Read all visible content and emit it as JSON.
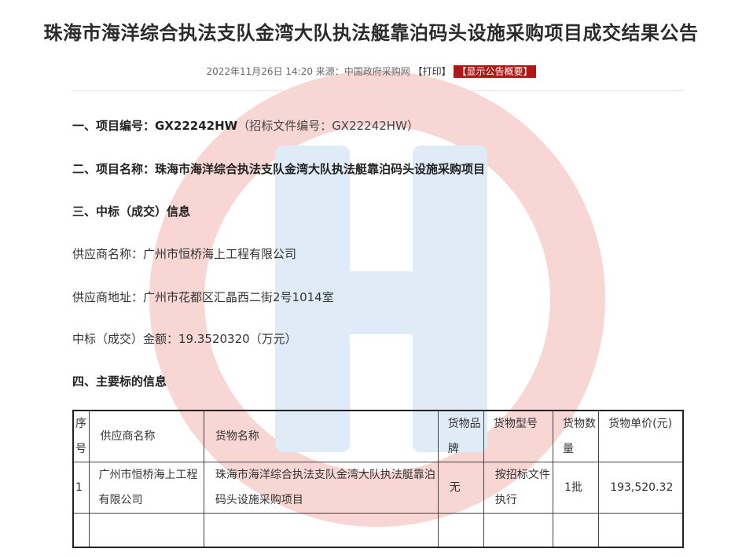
{
  "title": "珠海市海洋综合执法支队金湾大队执法艇靠泊码头设施采购项目成交结果公告",
  "meta": {
    "date": "2022年11月26日 14:20",
    "source": "来源：中国政府采购网",
    "print_label": "【打印】",
    "summary_label": "【显示公告概要】"
  },
  "sections": {
    "project_no_label": "一、项目编号：",
    "project_no_value": "GX22242HW",
    "project_no_extra": "（招标文件编号：GX22242HW）",
    "project_name_label": "二、项目名称：",
    "project_name_value": "珠海市海洋综合执法支队金湾大队执法艇靠泊码头设施采购项目",
    "award_heading": "三、中标（成交）信息",
    "supplier_name": "供应商名称：广州市恒桥海上工程有限公司",
    "supplier_address": "供应商地址：广州市花都区汇晶西二街2号1014室",
    "award_amount": "中标（成交）金额：19.3520320（万元）",
    "goods_heading": "四、主要标的信息"
  },
  "table": {
    "headers": {
      "seq": "序号",
      "supplier": "供应商名称",
      "goods_name": "货物名称",
      "brand": "货物品牌",
      "model": "货物型号",
      "quantity": "货物数量",
      "unit_price": "货物单价(元)"
    },
    "rows": [
      {
        "seq": "1",
        "supplier": "广州市恒桥海上工程有限公司",
        "goods_name": "珠海市海洋综合执法支队金湾大队执法艇靠泊码头设施采购项目",
        "brand": "无",
        "model": "按招标文件执行",
        "quantity": "1批",
        "unit_price": "193,520.32"
      }
    ]
  },
  "watermark": {
    "ring_color": "#f6d2cf",
    "letter_color": "#dbe9f6"
  }
}
